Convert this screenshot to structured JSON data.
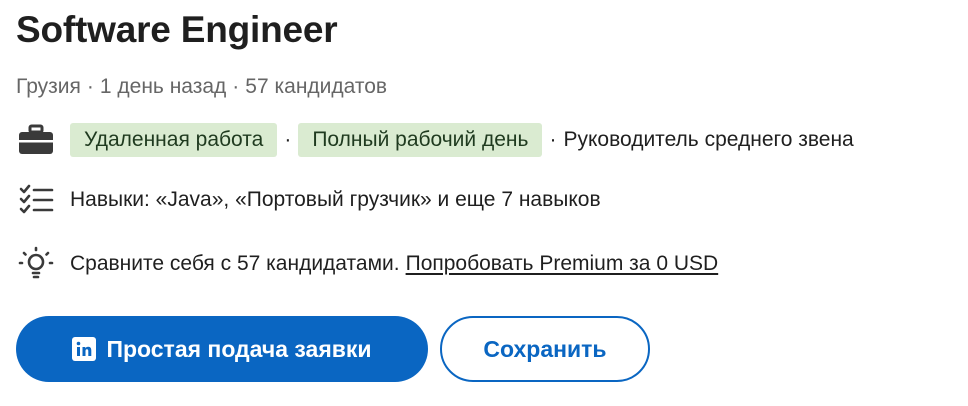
{
  "job": {
    "title": "Software Engineer",
    "location": "Грузия",
    "posted": "1 день назад",
    "applicants": "57 кандидатов",
    "separator": "·"
  },
  "workplace": {
    "icon": "briefcase-icon",
    "remote": "Удаленная работа",
    "job_type": "Полный рабочий день",
    "level": "Руководитель среднего звена"
  },
  "skills": {
    "icon": "checklist-icon",
    "text": "Навыки: «Java», «Портовый грузчик» и еще 7 навыков"
  },
  "premium": {
    "icon": "lightbulb-icon",
    "text": "Сравните себя с 57 кандидатами.",
    "link": "Попробовать Premium за 0 USD"
  },
  "actions": {
    "easy_apply": "Простая подача заявки",
    "easy_apply_icon": "linkedin-logo-icon",
    "save": "Сохранить"
  },
  "colors": {
    "brand_blue": "#0a66c2",
    "pill_green": "#daebd1",
    "secondary_text": "#666666"
  }
}
